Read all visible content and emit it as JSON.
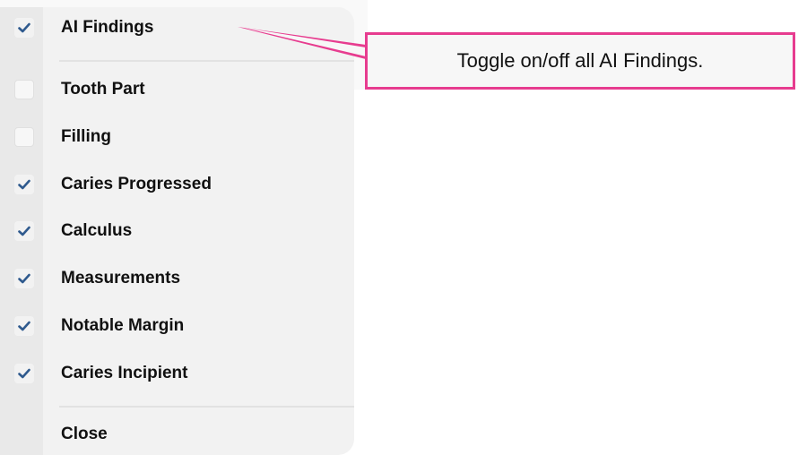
{
  "menu": {
    "items": [
      {
        "label": "AI Findings",
        "checked": true
      },
      {
        "label": "Tooth Part",
        "checked": false
      },
      {
        "label": "Filling",
        "checked": false
      },
      {
        "label": "Caries Progressed",
        "checked": true
      },
      {
        "label": "Calculus",
        "checked": true
      },
      {
        "label": "Measurements",
        "checked": true
      },
      {
        "label": "Notable Margin",
        "checked": true
      },
      {
        "label": "Caries Incipient",
        "checked": true
      }
    ],
    "close_label": "Close"
  },
  "callout": {
    "text": "Toggle on/off all AI Findings."
  },
  "colors": {
    "check_blue": "#2f5a8e",
    "callout_border": "#e73c8f"
  },
  "icons": {
    "check": "checkmark-icon"
  }
}
